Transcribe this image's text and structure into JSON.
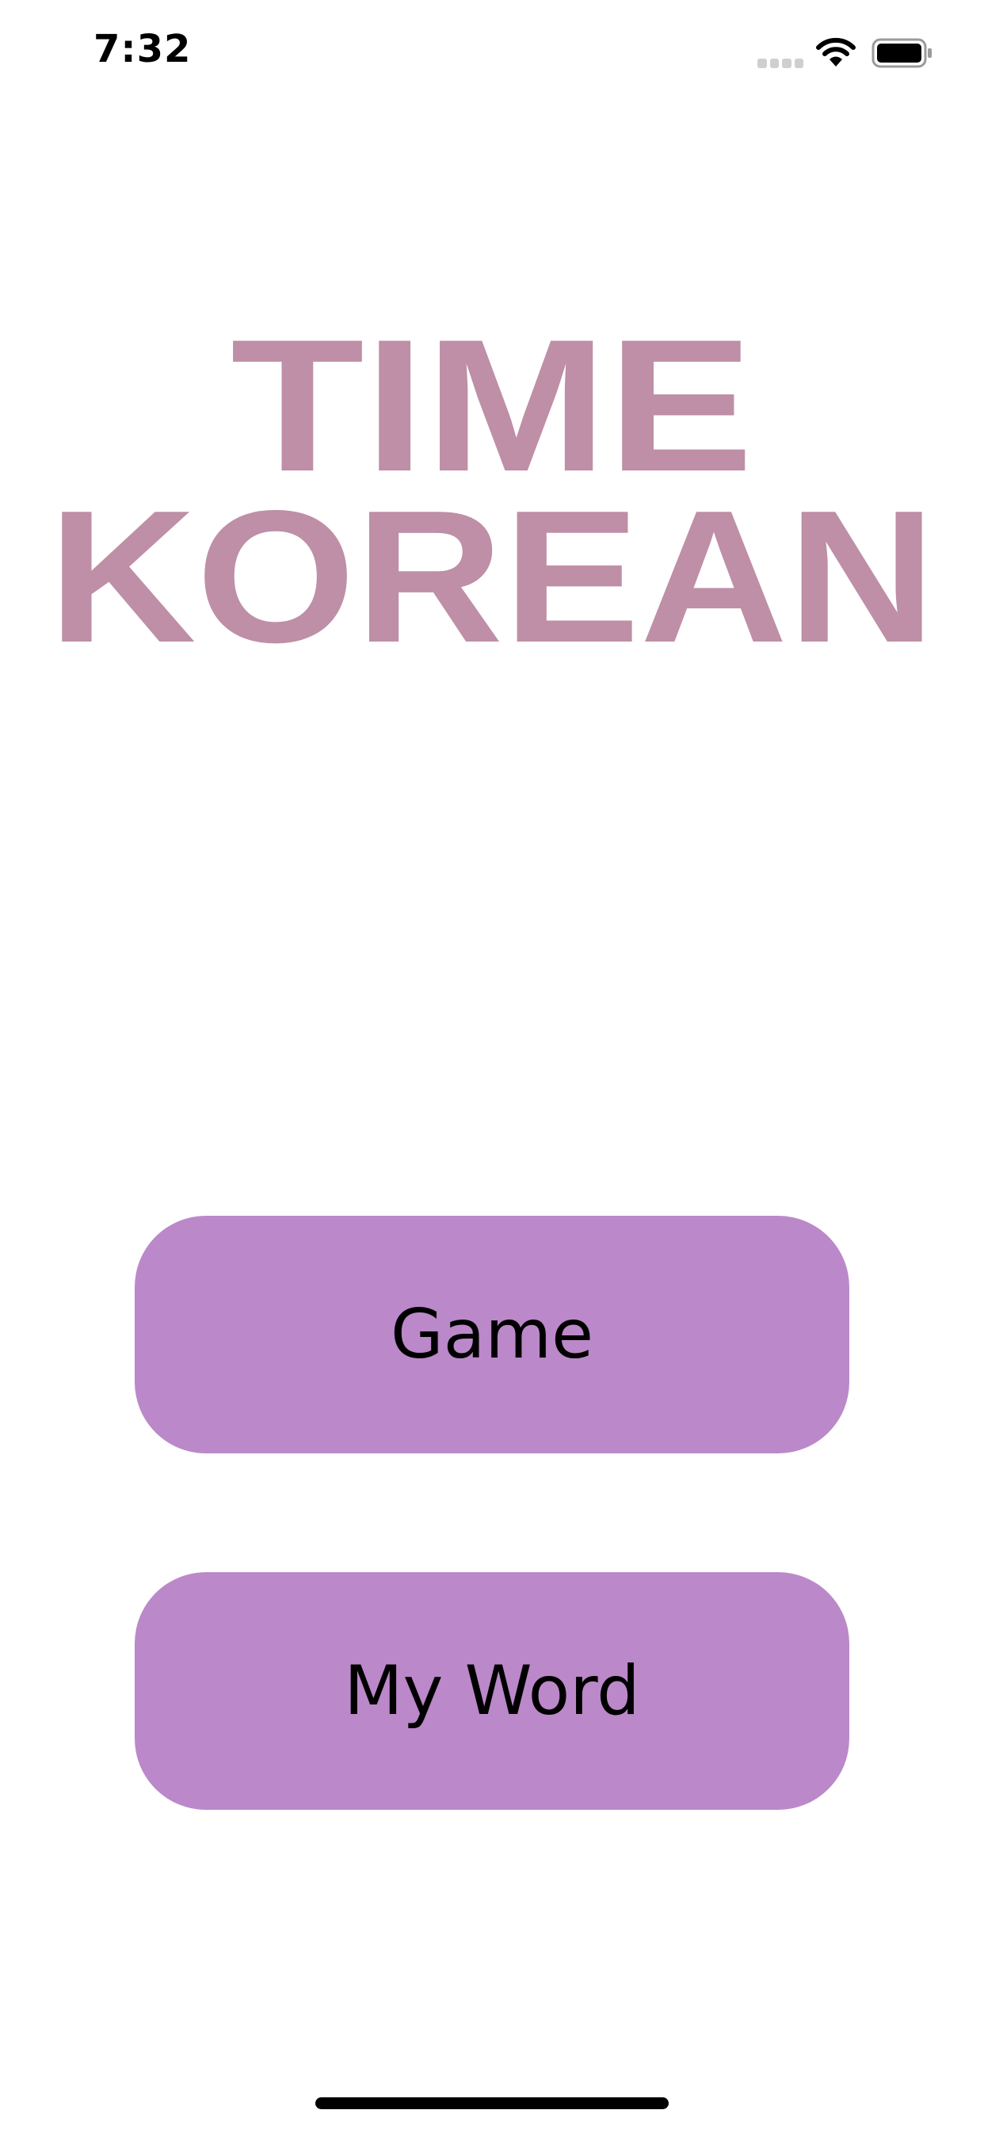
{
  "status_bar": {
    "time": "7:32",
    "wifi_icon": "wifi-icon",
    "battery_icon": "battery-icon",
    "signal_icon": "cell-signal-icon"
  },
  "logo": {
    "line1": "TIME",
    "line2": "KOREAN",
    "color": "#be8fa6"
  },
  "buttons": {
    "game": "Game",
    "my_word": "My Word",
    "color": "#bb88c9"
  }
}
